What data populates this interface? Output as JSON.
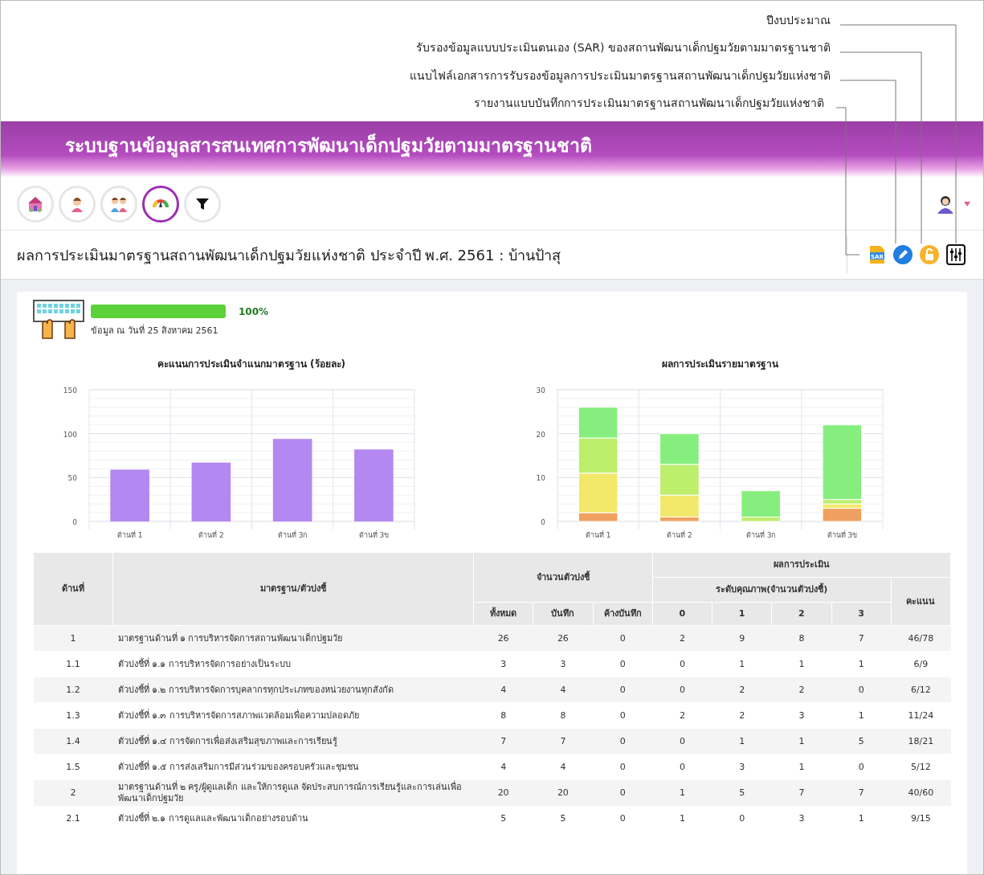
{
  "annotations": [
    {
      "label": "ปีงบประมาณ"
    },
    {
      "label": "รับรองข้อมูลแบบประเมินตนเอง (SAR) ของสถานพัฒนาเด็กปฐมวัยตามมาตรฐานชาติ"
    },
    {
      "label": "แนบไฟล์เอกสารการรับรองข้อมูลการประเมินมาตรฐานสถานพัฒนาเด็กปฐมวัยแห่งชาติ"
    },
    {
      "label": "รายงานแบบบันทึกการประเมินมาตรฐานสถานพัฒนาเด็กปฐมวัยแห่งชาติ"
    }
  ],
  "header": {
    "title": "ระบบฐานข้อมูลสารสนเทศการพัฒนาเด็กปฐมวัยตามมาตรฐานชาติ"
  },
  "toolbar": [
    {
      "kind": "school",
      "selected": false
    },
    {
      "kind": "teacher",
      "selected": false
    },
    {
      "kind": "children",
      "selected": false
    },
    {
      "kind": "gauge",
      "selected": true
    },
    {
      "kind": "filter",
      "selected": false
    }
  ],
  "page_title": "ผลการประเมินมาตรฐานสถานพัฒนาเด็กปฐมวัยแห่งชาติ ประจำปี พ.ศ. 2561 : บ้านป้าสุ",
  "actions": [
    {
      "kind": "sar",
      "label": "SAR"
    },
    {
      "kind": "pencil"
    },
    {
      "kind": "lock"
    },
    {
      "kind": "sliders"
    }
  ],
  "progress": {
    "level": 1,
    "label": "100%",
    "date": "ข้อมูล ณ วันที่ 25 สิงหาคม 2561"
  },
  "charts": [
    {
      "chart_data": {
        "type": "bar",
        "title": "คะแนนการประเมินจำแนกมาตรฐาน (ร้อยละ)",
        "categories": [
          "ด้านที่ 1",
          "ด้านที่ 2",
          "ด้านที่ 3ก",
          "ด้านที่ 3ข"
        ],
        "series": [
          {
            "color": "#b388f0",
            "values": [
              59,
              67,
              94,
              82
            ]
          }
        ],
        "ylim": [
          0,
          150
        ],
        "yticks": [
          0,
          50,
          100,
          150
        ]
      }
    },
    {
      "chart_data": {
        "type": "bar",
        "stacked": true,
        "title": "ผลการประเมินรายมาตรฐาน",
        "categories": [
          "ด้านที่ 1",
          "ด้านที่ 2",
          "ด้านที่ 3ก",
          "ด้านที่ 3ข"
        ],
        "series": [
          {
            "color": "#f0a060",
            "values": [
              2,
              1,
              0,
              3
            ]
          },
          {
            "color": "#f2e86a",
            "values": [
              9,
              5,
              0,
              1
            ]
          },
          {
            "color": "#bdee6c",
            "values": [
              8,
              7,
              1,
              1
            ]
          },
          {
            "color": "#86ee7e",
            "values": [
              7,
              7,
              6,
              17
            ]
          }
        ],
        "ylim": [
          0,
          30
        ],
        "yticks": [
          0,
          10,
          20,
          30
        ]
      }
    }
  ],
  "table": {
    "headers": {
      "side": "ด้านที่",
      "standard": "มาตรฐาน/ตัวบ่งชี้",
      "count_group": "จำนวนตัวบ่งชี้",
      "result_group": "ผลการประเมิน",
      "level_group": "ระดับคุณภาพ(จำนวนตัวบ่งชี้)",
      "score": "คะแนน",
      "counts": [
        "ทั้งหมด",
        "บันทึก",
        "ค้างบันทึก"
      ],
      "levels": [
        "0",
        "1",
        "2",
        "3"
      ]
    },
    "rows": [
      {
        "side": "1",
        "standard": "มาตรฐานด้านที่ ๑ การบริหารจัดการสถานพัฒนาเด็กปฐมวัย",
        "counts": [
          "26",
          "26",
          "0"
        ],
        "levels": [
          "2",
          "9",
          "8",
          "7"
        ],
        "score": "46/78"
      },
      {
        "side": "1.1",
        "standard": "ตัวบ่งชี้ที่ ๑.๑ การบริหารจัดการอย่างเป็นระบบ",
        "counts": [
          "3",
          "3",
          "0"
        ],
        "levels": [
          "0",
          "1",
          "1",
          "1"
        ],
        "score": "6/9"
      },
      {
        "side": "1.2",
        "standard": "ตัวบ่งชี้ที่ ๑.๒ การบริหารจัดการบุคลากรทุกประเภทของหน่วยงานทุกสังกัด",
        "counts": [
          "4",
          "4",
          "0"
        ],
        "levels": [
          "0",
          "2",
          "2",
          "0"
        ],
        "score": "6/12"
      },
      {
        "side": "1.3",
        "standard": "ตัวบ่งชี้ที่ ๑.๓ การบริหารจัดการสภาพแวดล้อมเพื่อความปลอดภัย",
        "counts": [
          "8",
          "8",
          "0"
        ],
        "levels": [
          "2",
          "2",
          "3",
          "1"
        ],
        "score": "11/24"
      },
      {
        "side": "1.4",
        "standard": "ตัวบ่งชี้ที่ ๑.๔ การจัดการเพื่อส่งเสริมสุขภาพและการเรียนรู้",
        "counts": [
          "7",
          "7",
          "0"
        ],
        "levels": [
          "0",
          "1",
          "1",
          "5"
        ],
        "score": "18/21"
      },
      {
        "side": "1.5",
        "standard": "ตัวบ่งชี้ที่ ๑.๕ การส่งเสริมการมีส่วนร่วมของครอบครัวและชุมชน",
        "counts": [
          "4",
          "4",
          "0"
        ],
        "levels": [
          "0",
          "3",
          "1",
          "0"
        ],
        "score": "5/12"
      },
      {
        "side": "2",
        "standard": "มาตรฐานด้านที่ ๒ ครู/ผู้ดูแลเด็ก และให้การดูแล จัดประสบการณ์การเรียนรู้และการเล่นเพื่อพัฒนาเด็กปฐมวัย",
        "counts": [
          "20",
          "20",
          "0"
        ],
        "levels": [
          "1",
          "5",
          "7",
          "7"
        ],
        "score": "40/60"
      },
      {
        "side": "2.1",
        "standard": "ตัวบ่งชี้ที่ ๒.๑ การดูแลและพัฒนาเด็กอย่างรอบด้าน",
        "counts": [
          "5",
          "5",
          "0"
        ],
        "levels": [
          "1",
          "0",
          "3",
          "1"
        ],
        "score": "9/15"
      }
    ]
  }
}
